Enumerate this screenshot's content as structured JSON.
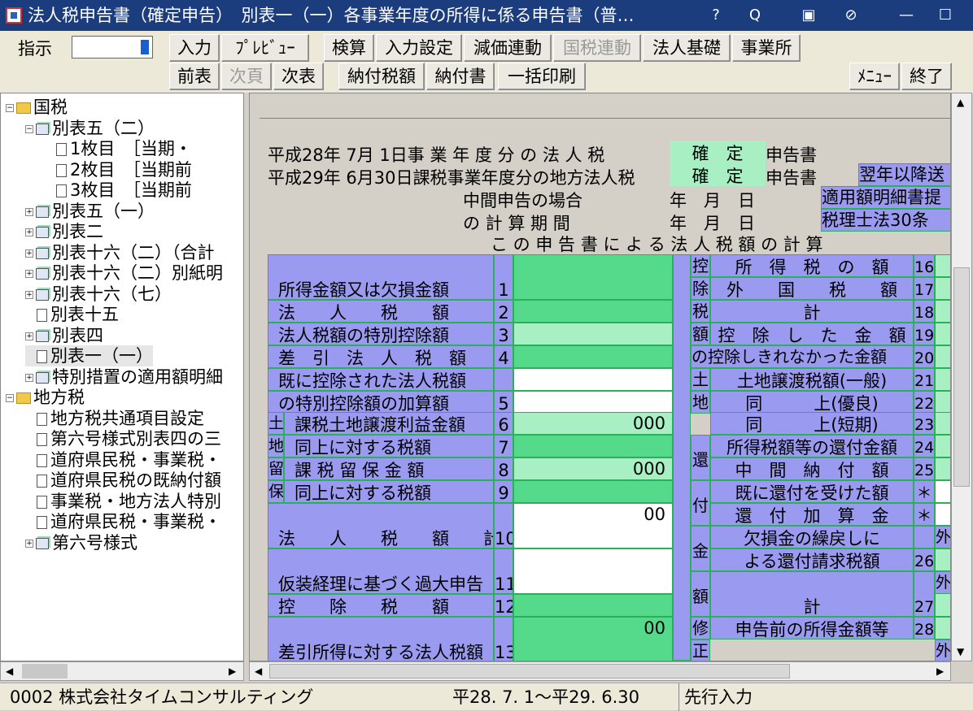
{
  "window": {
    "title": "法人税申告書（確定申告）　別表一（一）各事業年度の所得に係る申告書（普…",
    "help_icon": "?",
    "search_icon": "Q",
    "minimize": "—",
    "maximize": "☐"
  },
  "toolbar": {
    "instruction_label": "指示",
    "input": "入力",
    "preview": "ﾌﾟﾚﾋﾞｭｰ",
    "prev_table": "前表",
    "next_page": "次頁",
    "next_table": "次表",
    "kensan": "検算",
    "input_settings": "入力設定",
    "depreciation_link": "減価連動",
    "national_tax_link": "国税連動",
    "corp_basics": "法人基礎",
    "office": "事業所",
    "tax_amount": "納付税額",
    "payment_slip": "納付書",
    "batch_print": "一括印刷",
    "menu": "ﾒﾆｭｰ",
    "exit": "終了"
  },
  "tree": [
    {
      "label": "国税",
      "level": 0,
      "type": "folder",
      "exp": "⊟"
    },
    {
      "label": "別表五（二）",
      "level": 1,
      "type": "stack",
      "exp": "⊟"
    },
    {
      "label": "1枚目　［当期・",
      "level": 2,
      "type": "doc"
    },
    {
      "label": "2枚目　［当期前",
      "level": 2,
      "type": "doc"
    },
    {
      "label": "3枚目　［当期前",
      "level": 2,
      "type": "doc"
    },
    {
      "label": "別表五（一）",
      "level": 1,
      "type": "stack",
      "exp": "⊞"
    },
    {
      "label": "別表二",
      "level": 1,
      "type": "stack",
      "exp": "⊞"
    },
    {
      "label": "別表十六（二）（合計",
      "level": 1,
      "type": "stack",
      "exp": "⊞"
    },
    {
      "label": "別表十六（二）別紙明",
      "level": 1,
      "type": "stack",
      "exp": "⊞"
    },
    {
      "label": "別表十六（七）",
      "level": 1,
      "type": "stack",
      "exp": "⊞"
    },
    {
      "label": "別表十五",
      "level": 1,
      "type": "doc"
    },
    {
      "label": "別表四",
      "level": 1,
      "type": "stack",
      "exp": "⊞"
    },
    {
      "label": "別表一（一）",
      "level": 1,
      "type": "doc"
    },
    {
      "label": "特別措置の適用額明細",
      "level": 1,
      "type": "stack",
      "exp": "⊞"
    },
    {
      "label": "地方税",
      "level": 0,
      "type": "folder",
      "exp": "⊟"
    },
    {
      "label": "地方税共通項目設定",
      "level": 1,
      "type": "doc"
    },
    {
      "label": "第六号様式別表四の三",
      "level": 1,
      "type": "doc"
    },
    {
      "label": "道府県民税・事業税・",
      "level": 1,
      "type": "doc"
    },
    {
      "label": "道府県民税の既納付額",
      "level": 1,
      "type": "doc"
    },
    {
      "label": "事業税・地方法人特別",
      "level": 1,
      "type": "doc"
    },
    {
      "label": "道府県民税・事業税・",
      "level": 1,
      "type": "doc"
    },
    {
      "label": "第六号様式",
      "level": 1,
      "type": "stack",
      "exp": "⊞"
    }
  ],
  "form": {
    "header1a": "平成28年 7月 1日事 業 年 度 分 の 法 人 税",
    "header1b": "確　定",
    "header1c": "申告書",
    "header2a": "平成29年 6月30日課税事業年度分の地方法人税",
    "header2b": "確　定",
    "header2c": "申告書",
    "next_year": "翌年以降送",
    "interim1": "中間申告の場合",
    "interim2": "の 計 算 期 間",
    "ymd1": "年　月　日",
    "ymd2": "年　月　日",
    "applied_detail": "適用額明細書提",
    "tax_accountant": "税理士法30条",
    "calc_title": "こ の 申 告 書 に よ る 法 人 税 額 の 計 算",
    "left_rows": [
      {
        "label": "所得金額又は欠損金額",
        "no": "1",
        "value": ""
      },
      {
        "label": "法　　人　　税　　額",
        "no": "2",
        "value": ""
      },
      {
        "label": "法人税額の特別控除額",
        "no": "3",
        "value": ""
      },
      {
        "label": "差　引　法　人　税　額",
        "no": "4",
        "value": ""
      },
      {
        "label": "既に控除された法人税額",
        "no": "",
        "value": ""
      },
      {
        "label": "の特別控除額の加算額",
        "no": "5",
        "value": ""
      },
      {
        "label": "課税土地譲渡利益金額",
        "no": "6",
        "value": "000"
      },
      {
        "label": "同上に対する税額",
        "no": "7",
        "value": ""
      },
      {
        "label": "課 税 留 保 金 額",
        "no": "8",
        "value": "000"
      },
      {
        "label": "同上に対する税額",
        "no": "9",
        "value": ""
      },
      {
        "label": "法　　人　　税　　額　　計",
        "no": "10",
        "value": "00"
      },
      {
        "label": "仮装経理に基づく過大申告",
        "no": "11",
        "value": ""
      },
      {
        "label": "控　　除　　税　　額",
        "no": "12",
        "value": ""
      },
      {
        "label": "差引所得に対する法人税額",
        "no": "13",
        "value": "00"
      }
    ],
    "side_left": [
      "土",
      "地",
      "留",
      "保"
    ],
    "side_right1": [
      "控",
      "除",
      "税",
      "額"
    ],
    "side_right1b": "の控除しきれなかった金額",
    "side_right2": [
      "土",
      "地"
    ],
    "side_right3": [
      "還",
      "付",
      "金",
      "額"
    ],
    "side_right4": [
      "修",
      "正"
    ],
    "right_rows": [
      {
        "label": "所　得　税　の　額",
        "no": "16"
      },
      {
        "label": "外　　国　　税　　額",
        "no": "17"
      },
      {
        "label": "計",
        "no": "18"
      },
      {
        "label": "控　除　し　た　金　額",
        "no": "19"
      },
      {
        "label": "控除しきれなかった金額",
        "no": "20"
      },
      {
        "label": "土地譲渡税額(一般)",
        "no": "21"
      },
      {
        "label": "同　　　上(優良)",
        "no": "22"
      },
      {
        "label": "同　　　上(短期)",
        "no": "23"
      },
      {
        "label": "所得税額等の還付金額",
        "no": "24"
      },
      {
        "label": "中　間　納　付　額",
        "no": "25"
      },
      {
        "label": "既に還付を受けた額",
        "no": "＊"
      },
      {
        "label": "還　付　加　算　金",
        "no": "＊"
      },
      {
        "label": "欠損金の繰戻しに",
        "no": ""
      },
      {
        "label": "よる還付請求税額",
        "no": "26"
      },
      {
        "label": "計",
        "no": "27"
      },
      {
        "label": "申告前の所得金額等",
        "no": "28"
      }
    ],
    "outside": "外"
  },
  "status": {
    "company": "0002 株式会社タイムコンサルティング",
    "period": "平28. 7. 1～平29. 6.30",
    "mode": "先行入力"
  }
}
